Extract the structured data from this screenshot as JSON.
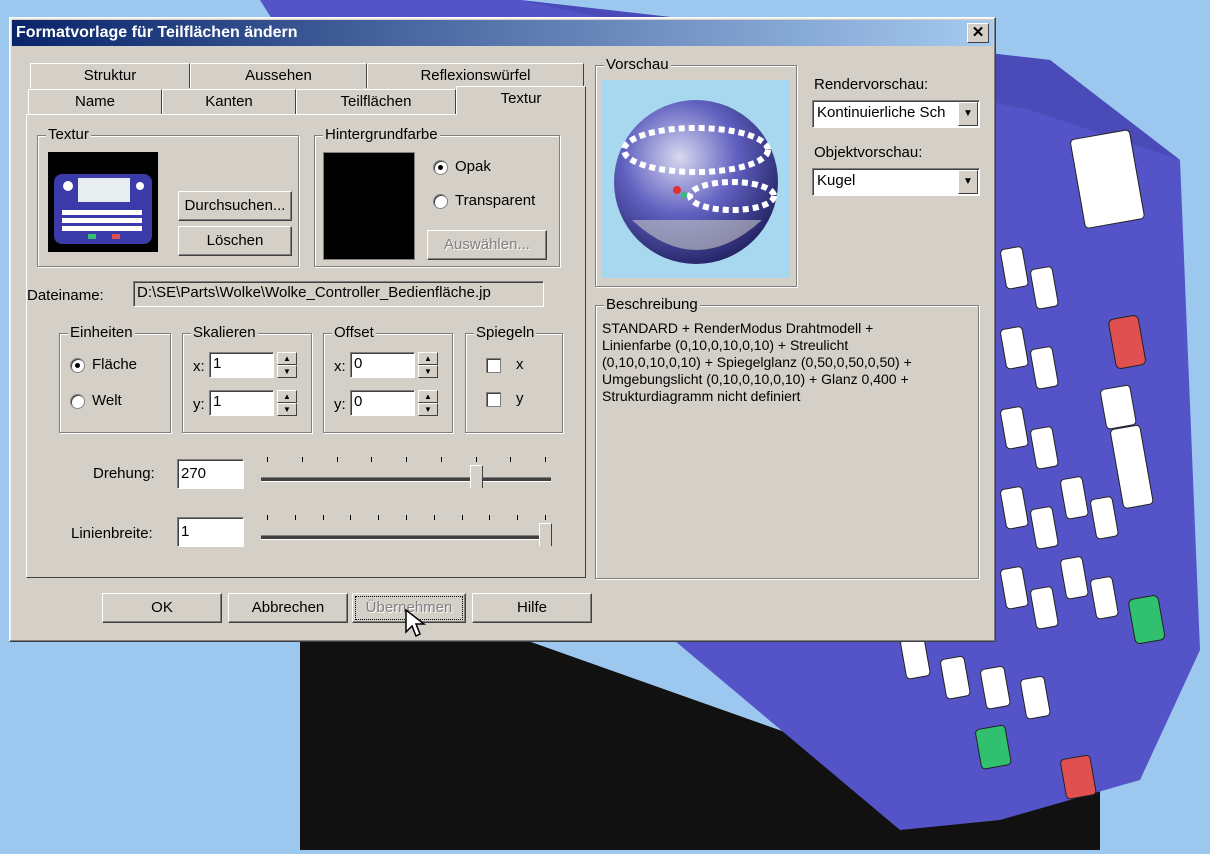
{
  "dialog": {
    "title": "Formatvorlage für Teilflächen ändern",
    "close_glyph": "✕"
  },
  "tabs": {
    "row1": [
      "Struktur",
      "Aussehen",
      "Reflexionswürfel"
    ],
    "row2": [
      "Name",
      "Kanten",
      "Teilflächen",
      "Textur"
    ],
    "active": "Textur"
  },
  "texture": {
    "group_label": "Textur",
    "browse_label": "Durchsuchen...",
    "delete_label": "Löschen"
  },
  "background": {
    "group_label": "Hintergrundfarbe",
    "opaque_label": "Opak",
    "transparent_label": "Transparent",
    "select_label": "Auswählen...",
    "selected": "Opak",
    "color": "#000000"
  },
  "filename": {
    "label": "Dateiname:",
    "value": "D:\\SE\\Parts\\Wolke\\Wolke_Controller_Bedienfläche.jp"
  },
  "units": {
    "group_label": "Einheiten",
    "area_label": "Fläche",
    "world_label": "Welt",
    "selected": "Fläche"
  },
  "scale": {
    "group_label": "Skalieren",
    "x_label": "x:",
    "x_value": "1",
    "y_label": "y:",
    "y_value": "1"
  },
  "offset": {
    "group_label": "Offset",
    "x_label": "x:",
    "x_value": "0",
    "y_label": "y:",
    "y_value": "0"
  },
  "mirror": {
    "group_label": "Spiegeln",
    "x_label": "x",
    "y_label": "y",
    "x_checked": false,
    "y_checked": false
  },
  "rotation": {
    "label": "Drehung:",
    "value": "270",
    "slider_fraction": 0.75
  },
  "linewidth": {
    "label": "Linienbreite:",
    "value": "1",
    "slider_fraction": 1.0
  },
  "preview": {
    "group_label": "Vorschau",
    "render_label": "Rendervorschau:",
    "render_value": "Kontinuierliche Sch",
    "object_label": "Objektvorschau:",
    "object_value": "Kugel"
  },
  "description": {
    "group_label": "Beschreibung",
    "lines": [
      "STANDARD + RenderModus Drahtmodell +",
      "Linienfarbe (0,10,0,10,0,10) + Streulicht",
      "(0,10,0,10,0,10) + Spiegelglanz (0,50,0,50,0,50) +",
      "Umgebungslicht (0,10,0,10,0,10) + Glanz 0,400 +",
      "Strukturdiagramm nicht definiert"
    ]
  },
  "buttons": {
    "ok": "OK",
    "cancel": "Abbrechen",
    "apply": "Übernehmen",
    "help": "Hilfe"
  },
  "colors": {
    "desktop": "#9cc8ef",
    "dialog_face": "#d4d0c8",
    "title_start": "#0a246a",
    "title_end": "#a6caf0",
    "model_face": "#5454c8"
  }
}
